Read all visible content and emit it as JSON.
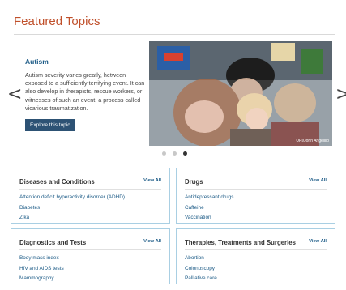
{
  "featured": {
    "title": "Featured Topics",
    "slide": {
      "heading": "Autism",
      "body_struck": "Autism severity varies greatly, hetween",
      "body": "exposed to a sufficiently terrifying event. It can also develop in therapists, rescue workers, or witnesses of such an event, a process called vicarious traumatization.",
      "button_label": "Explore this topic",
      "photo_credit": "UPI/John Angelillo"
    },
    "prev_arrow": "<",
    "next_arrow": ">",
    "dots": {
      "count": 3,
      "active_index": 2
    }
  },
  "cards": [
    {
      "heading": "Diseases and Conditions",
      "view_all": "View All",
      "links": [
        "Attention deficit hyperactivity disorder (ADHD)",
        "Diabetes",
        "Zika"
      ]
    },
    {
      "heading": "Drugs",
      "view_all": "View All",
      "links": [
        "Antidepressant drugs",
        "Caffeine",
        "Vaccination"
      ]
    },
    {
      "heading": "Diagnostics and Tests",
      "view_all": "View All",
      "links": [
        "Body mass index",
        "HIV and AIDS tests",
        "Mammography"
      ]
    },
    {
      "heading": "Therapies, Treatments and Surgeries",
      "view_all": "View All",
      "links": [
        "Abortion",
        "Colonoscopy",
        "Palliative care"
      ]
    }
  ],
  "colors": {
    "title": "#c0502b",
    "link": "#1b5a86",
    "button": "#2d5274",
    "card_border": "#a9cfe3"
  },
  "icons": {
    "prev": "chevron-left-icon",
    "next": "chevron-right-icon"
  }
}
